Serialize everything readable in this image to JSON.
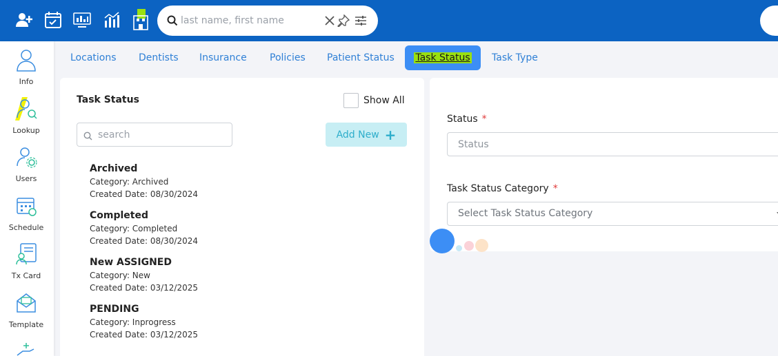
{
  "topbar": {
    "icons": [
      "add-user-icon",
      "calendar-check-icon",
      "monitor-chart-icon",
      "bar-chart-icon",
      "building-icon"
    ],
    "search": {
      "placeholder": "last name, first name",
      "value": ""
    }
  },
  "sidebar": {
    "items": [
      {
        "label": "Info",
        "icon": "person-icon"
      },
      {
        "label": "Lookup",
        "icon": "person-search-icon"
      },
      {
        "label": "Users",
        "icon": "user-gear-icon"
      },
      {
        "label": "Schedule",
        "icon": "calendar-icon"
      },
      {
        "label": "Tx Card",
        "icon": "card-person-icon"
      },
      {
        "label": "Template",
        "icon": "envelope-icon"
      }
    ]
  },
  "tabs": [
    {
      "label": "Locations"
    },
    {
      "label": "Dentists"
    },
    {
      "label": "Insurance"
    },
    {
      "label": "Policies"
    },
    {
      "label": "Patient Status"
    },
    {
      "label": "Task Status",
      "active": true
    },
    {
      "label": "Task Type"
    }
  ],
  "list_panel": {
    "title": "Task Status",
    "show_all_label": "Show All",
    "show_all_checked": false,
    "search_placeholder": "search",
    "add_label": "Add New",
    "items": [
      {
        "name": "Archived",
        "category": "Category: Archived",
        "created": "Created Date: 08/30/2024"
      },
      {
        "name": "Completed",
        "category": "Category: Completed",
        "created": "Created Date: 08/30/2024"
      },
      {
        "name": "New ASSIGNED",
        "category": "Category: New",
        "created": "Created Date: 03/12/2025"
      },
      {
        "name": "PENDING",
        "category": "Category: Inprogress",
        "created": "Created Date: 03/12/2025"
      }
    ]
  },
  "form": {
    "status_label": "Status",
    "status_placeholder": "Status",
    "category_label": "Task Status Category",
    "category_placeholder": "Select Task Status Category",
    "required_mark": "*"
  },
  "colors": {
    "topbar": "#0c63c2",
    "tab_text": "#2f80d6",
    "active_tab": "#3c8ef5",
    "add_button_bg": "#c7eef4",
    "add_button_text": "#2eaecb",
    "required": "#e03a3a"
  }
}
